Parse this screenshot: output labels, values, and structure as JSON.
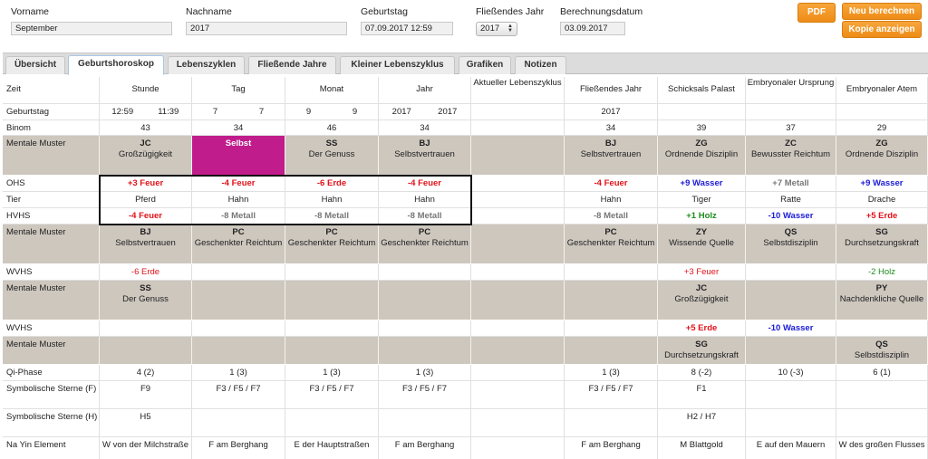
{
  "form": {
    "vorname": {
      "label": "Vorname",
      "value": "September"
    },
    "nachname": {
      "label": "Nachname",
      "value": "2017"
    },
    "geburtstag": {
      "label": "Geburtstag",
      "value": "07.09.2017 12:59"
    },
    "jahr": {
      "label": "Fließendes Jahr",
      "value": "2017"
    },
    "datum": {
      "label": "Berechnungsdatum",
      "value": "03.09.2017"
    }
  },
  "buttons": {
    "pdf": "PDF",
    "neu": "Neu berechnen",
    "kopie": "Kopie anzeigen"
  },
  "colors": {
    "accent": "#ee8c17",
    "magenta": "#c01c8c",
    "red": "#e0121a",
    "blue": "#1b1bd6",
    "green": "#1c8c1c",
    "tan": "#cdc7be"
  },
  "tabs": [
    "Übersicht",
    "Geburtshoroskop",
    "Lebenszyklen",
    "Fließende Jahre",
    "Kleiner Lebenszyklus",
    "Grafiken",
    "Notizen"
  ],
  "table": {
    "headers": [
      "Zeit",
      "Stunde",
      "Tag",
      "Monat",
      "Jahr",
      "Aktueller Lebenszyklus",
      "Fließendes Jahr",
      "Schicksals Palast",
      "Embryonaler Ursprung",
      "Embryonaler Atem"
    ],
    "geburtstag": {
      "label": "Geburtstag",
      "stunde": [
        "12:59",
        "11:39"
      ],
      "tag": [
        "7",
        "7"
      ],
      "monat": [
        "9",
        "9"
      ],
      "jahr": [
        "2017",
        "2017"
      ],
      "fj": "2017"
    },
    "binom": {
      "label": "Binom",
      "values": [
        "43",
        "34",
        "46",
        "34",
        "",
        "34",
        "39",
        "37",
        "29"
      ]
    },
    "mm1": {
      "label": "Mentale Muster",
      "cells": [
        {
          "code": "JC",
          "name": "Großzügigkeit"
        },
        {
          "code": "Selbst",
          "name": ""
        },
        {
          "code": "SS",
          "name": "Der Genuss"
        },
        {
          "code": "BJ",
          "name": "Selbstvertrauen"
        },
        {
          "code": "",
          "name": ""
        },
        {
          "code": "BJ",
          "name": "Selbstvertrauen"
        },
        {
          "code": "ZG",
          "name": "Ordnende Disziplin"
        },
        {
          "code": "ZC",
          "name": "Bewusster Reichtum"
        },
        {
          "code": "ZG",
          "name": "Ordnende Disziplin"
        }
      ]
    },
    "ohs": {
      "label": "OHS",
      "values": [
        "+3 Feuer",
        "-4 Feuer",
        "-6 Erde",
        "-4 Feuer",
        "",
        "-4 Feuer",
        "+9 Wasser",
        "+7 Metall",
        "+9 Wasser"
      ]
    },
    "tier": {
      "label": "Tier",
      "values": [
        "Pferd",
        "Hahn",
        "Hahn",
        "Hahn",
        "",
        "Hahn",
        "Tiger",
        "Ratte",
        "Drache"
      ]
    },
    "hvhs": {
      "label": "HVHS",
      "values": [
        "-4 Feuer",
        "-8 Metall",
        "-8 Metall",
        "-8 Metall",
        "",
        "-8 Metall",
        "+1 Holz",
        "-10 Wasser",
        "+5 Erde"
      ]
    },
    "mm2": {
      "label": "Mentale Muster",
      "cells": [
        {
          "code": "BJ",
          "name": "Selbstvertrauen"
        },
        {
          "code": "PC",
          "name": "Geschenkter Reichtum"
        },
        {
          "code": "PC",
          "name": "Geschenkter Reichtum"
        },
        {
          "code": "PC",
          "name": "Geschenkter Reichtum"
        },
        {
          "code": "",
          "name": ""
        },
        {
          "code": "PC",
          "name": "Geschenkter Reichtum"
        },
        {
          "code": "ZY",
          "name": "Wissende Quelle"
        },
        {
          "code": "QS",
          "name": "Selbstdisziplin"
        },
        {
          "code": "SG",
          "name": "Durchsetzungskraft"
        }
      ]
    },
    "wvhs1": {
      "label": "WVHS",
      "values": [
        "-6 Erde",
        "",
        "",
        "",
        "",
        "",
        "+3 Feuer",
        "",
        "-2 Holz"
      ]
    },
    "mm3": {
      "label": "Mentale Muster",
      "cells": [
        {
          "code": "SS",
          "name": "Der Genuss"
        },
        {
          "code": "",
          "name": ""
        },
        {
          "code": "",
          "name": ""
        },
        {
          "code": "",
          "name": ""
        },
        {
          "code": "",
          "name": ""
        },
        {
          "code": "",
          "name": ""
        },
        {
          "code": "JC",
          "name": "Großzügigkeit"
        },
        {
          "code": "",
          "name": ""
        },
        {
          "code": "PY",
          "name": "Nachdenkliche Quelle"
        }
      ]
    },
    "wvhs2": {
      "label": "WVHS",
      "values": [
        "",
        "",
        "",
        "",
        "",
        "",
        "+5 Erde",
        "-10 Wasser",
        ""
      ]
    },
    "mm4": {
      "label": "Mentale Muster",
      "cells": [
        {
          "code": "",
          "name": ""
        },
        {
          "code": "",
          "name": ""
        },
        {
          "code": "",
          "name": ""
        },
        {
          "code": "",
          "name": ""
        },
        {
          "code": "",
          "name": ""
        },
        {
          "code": "",
          "name": ""
        },
        {
          "code": "SG",
          "name": "Durchsetzungskraft"
        },
        {
          "code": "",
          "name": ""
        },
        {
          "code": "QS",
          "name": "Selbstdisziplin"
        }
      ]
    },
    "qi": {
      "label": "Qi-Phase",
      "values": [
        "4 (2)",
        "1 (3)",
        "1 (3)",
        "1 (3)",
        "",
        "1 (3)",
        "8 (-2)",
        "10 (-3)",
        "6 (1)"
      ]
    },
    "sf": {
      "label": "Symbolische Sterne (F)",
      "values": [
        "F9",
        "F3 / F5 / F7",
        "F3 / F5 / F7",
        "F3 / F5 / F7",
        "",
        "F3 / F5 / F7",
        "F1",
        "",
        ""
      ]
    },
    "sh": {
      "label": "Symbolische Sterne (H)",
      "values": [
        "H5",
        "",
        "",
        "",
        "",
        "",
        "H2 / H7",
        "",
        ""
      ]
    },
    "nayin": {
      "label": "Na Yin Element",
      "values": [
        "W von der Milchstraße",
        "F am Berghang",
        "E der Hauptstraßen",
        "F am Berghang",
        "",
        "F am Berghang",
        "M Blattgold",
        "E auf den Mauern",
        "W des großen Flusses"
      ]
    }
  }
}
